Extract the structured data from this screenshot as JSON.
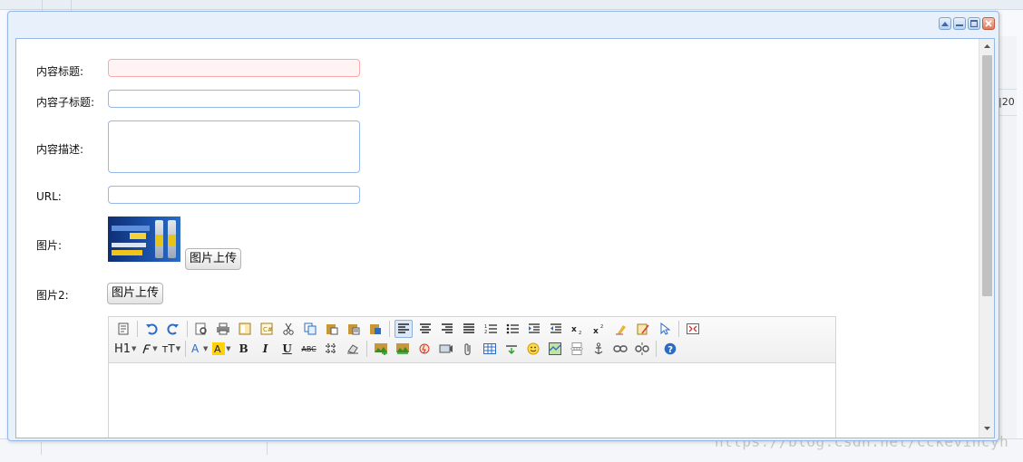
{
  "form": {
    "title_label": "内容标题:",
    "subtitle_label": "内容子标题:",
    "desc_label": "内容描述:",
    "url_label": "URL:",
    "image_label": "图片:",
    "image2_label": "图片2:",
    "upload_label": "图片上传",
    "upload2_label": "图片上传"
  },
  "editor": {
    "toolbar_row1": [
      "source-icon",
      "undo-icon",
      "redo-icon",
      "preview-icon",
      "print-icon",
      "template-icon",
      "code-icon",
      "cut-icon",
      "copy-icon",
      "paste-icon",
      "paste-text-icon",
      "paste-word-icon",
      "align-left-icon",
      "align-center-icon",
      "align-right-icon",
      "align-justify-icon",
      "ordered-list-icon",
      "unordered-list-icon",
      "indent-icon",
      "outdent-icon",
      "subscript-icon",
      "superscript-icon",
      "clear-format-icon",
      "select-all-icon",
      "pointer-icon",
      "fullscreen-icon"
    ],
    "heading_label": "H1",
    "fontsize_label": "тT",
    "bold_label": "B",
    "italic_label": "I",
    "underline_label": "U",
    "strike_label": "ABC"
  },
  "background": {
    "right_cell_text": "|20",
    "watermark": "https://blog.csdn.net/cckevincyh"
  },
  "colors": {
    "window_border": "#95b8e7",
    "invalid_bg": "#fff3f3",
    "invalid_border": "#ffa8a8",
    "help_icon": "#2b6cc4"
  }
}
